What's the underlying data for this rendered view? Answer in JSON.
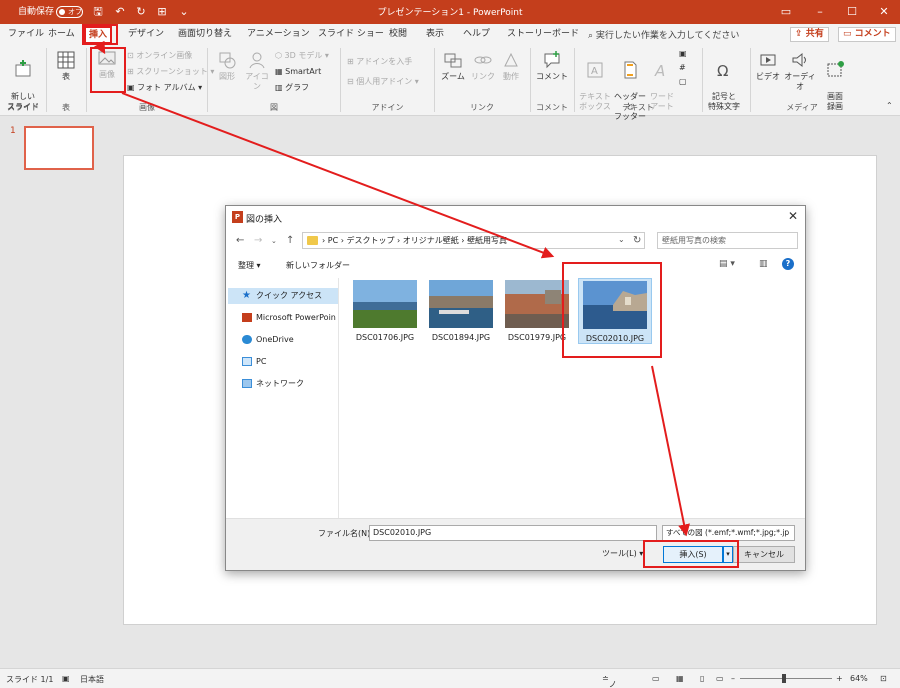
{
  "colors": {
    "accent": "#c43e1c",
    "annotation": "#e31d1d",
    "selection": "#cce4f7"
  },
  "titlebar": {
    "autosave_label": "自動保存",
    "autosave_state": "オフ",
    "title": "プレゼンテーション1 - PowerPoint"
  },
  "tabs": [
    "ファイル",
    "ホーム",
    "挿入",
    "デザイン",
    "画面切り替え",
    "アニメーション",
    "スライド ショー",
    "校閲",
    "表示",
    "ヘルプ",
    "ストーリーボード"
  ],
  "tell_me": "実行したい作業を入力してください",
  "share_label": "共有",
  "comments_label": "コメント",
  "ribbon": {
    "new_slide": "新しい\nスライド",
    "table": "表",
    "image": "画像",
    "online_image": "オンライン画像",
    "screenshot": "スクリーンショット",
    "photo_album": "フォト アルバム",
    "shapes": "図形",
    "icons": "アイコン",
    "model3d": "3D モデル",
    "smartart": "SmartArt",
    "graph": "グラフ",
    "get_addins": "アドインを入手",
    "my_addins": "個人用アドイン",
    "zoom": "ズーム",
    "link": "リンク",
    "action": "動作",
    "comment": "コメント",
    "textbox": "テキスト\nボックス",
    "header_footer": "ヘッダーと\nフッター",
    "wordart": "ワード\nアート",
    "symbols": "記号と\n特殊文字",
    "video": "ビデオ",
    "audio": "オーディオ",
    "screen_record": "画面\n録画",
    "groups": {
      "slides": "スライド",
      "tables": "表",
      "images": "画像",
      "illustrations": "図",
      "addins": "アドイン",
      "links": "リンク",
      "comments": "コメント",
      "text": "テキスト",
      "media": "メディア"
    }
  },
  "thumb": {
    "slide_number": "1"
  },
  "status": {
    "slide": "スライド 1/1",
    "language": "日本語",
    "notes": "ノート",
    "zoom": "64%"
  },
  "dialog": {
    "title": "図の挿入",
    "breadcrumb": [
      "PC",
      "デスクトップ",
      "オリジナル壁紙",
      "壁紙用写真"
    ],
    "search_placeholder": "壁紙用写真の検索",
    "organize": "整理 ▾",
    "new_folder": "新しいフォルダー",
    "nav": [
      "クイック アクセス",
      "Microsoft PowerPoin",
      "OneDrive",
      "PC",
      "ネットワーク"
    ],
    "files": [
      "DSC01706.JPG",
      "DSC01894.JPG",
      "DSC01979.JPG",
      "DSC02010.JPG"
    ],
    "filename_label": "ファイル名(N):",
    "filename_value": "DSC02010.JPG",
    "filetype": "すべての図 (*.emf;*.wmf;*.jpg;*.jp",
    "tools": "ツール(L)",
    "insert": "挿入(S)",
    "cancel": "キャンセル"
  }
}
